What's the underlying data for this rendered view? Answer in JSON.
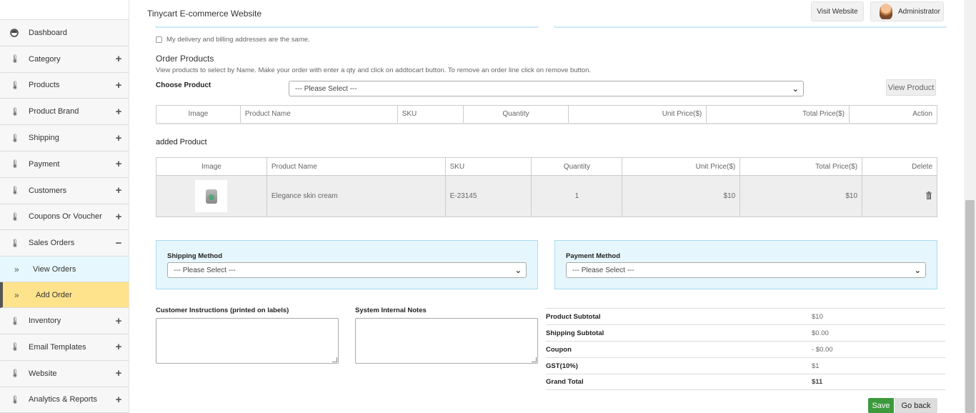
{
  "header": {
    "site_title": "Tinycart E-commerce Website",
    "visit_label": "Visit Website",
    "admin_label": "Administrator"
  },
  "sidebar": {
    "items": [
      {
        "label": "Dashboard",
        "icon": "dashboard-icon",
        "expand": ""
      },
      {
        "label": "Category",
        "icon": "thermometer-icon",
        "expand": "+"
      },
      {
        "label": "Products",
        "icon": "thermometer-icon",
        "expand": "+"
      },
      {
        "label": "Product Brand",
        "icon": "thermometer-icon",
        "expand": "+"
      },
      {
        "label": "Shipping",
        "icon": "thermometer-icon",
        "expand": "+"
      },
      {
        "label": "Payment",
        "icon": "thermometer-icon",
        "expand": "+"
      },
      {
        "label": "Customers",
        "icon": "thermometer-icon",
        "expand": "+"
      },
      {
        "label": "Coupons Or Voucher",
        "icon": "thermometer-icon",
        "expand": "+"
      },
      {
        "label": "Sales Orders",
        "icon": "thermometer-icon",
        "expand": "−"
      }
    ],
    "sub_items": [
      {
        "label": "View Orders",
        "icon": "double-chevron-icon"
      },
      {
        "label": "Add Order",
        "icon": "double-chevron-icon"
      }
    ],
    "items_after": [
      {
        "label": "Inventory",
        "icon": "thermometer-icon",
        "expand": "+"
      },
      {
        "label": "Email Templates",
        "icon": "thermometer-icon",
        "expand": "+"
      },
      {
        "label": "Website",
        "icon": "thermometer-icon",
        "expand": "+"
      },
      {
        "label": "Analytics & Reports",
        "icon": "thermometer-icon",
        "expand": "+"
      }
    ]
  },
  "form": {
    "same_address_label": "My delivery and billing addresses are the same.",
    "order_products_title": "Order Products",
    "order_products_desc": "View products to select by Name. Make your order with enter a qty and click on addtocart button. To remove an order line click on remove button.",
    "choose_product_label": "Choose Product",
    "choose_product_value": "--- Please Select ---",
    "view_product_label": "View Product"
  },
  "search_table": {
    "headers": [
      "Image",
      "Product Name",
      "SKU",
      "Quantity",
      "Unit Price($)",
      "Total Price($)",
      "Action"
    ]
  },
  "added_table": {
    "title": "added Product",
    "headers": [
      "Image",
      "Product Name",
      "SKU",
      "Quantity",
      "Unit Price($)",
      "Total Price($)",
      "Delete"
    ],
    "rows": [
      {
        "name": "Elegance skin cream",
        "sku": "E-23145",
        "qty": "1",
        "unit": "$10",
        "total": "$10"
      }
    ]
  },
  "shipping": {
    "label": "Shipping Method",
    "value": "--- Please Select ---"
  },
  "payment": {
    "label": "Payment Method",
    "value": "--- Please Select ---"
  },
  "notes": {
    "customer_label": "Customer Instructions (printed on labels)",
    "internal_label": "System Internal Notes"
  },
  "totals": [
    {
      "label": "Product Subtotal",
      "value": "$10"
    },
    {
      "label": "Shipping Subtotal",
      "value": "$0.00"
    },
    {
      "label": "Coupon",
      "value": "- $0.00"
    },
    {
      "label": "GST(10%)",
      "value": "$1"
    },
    {
      "label": "Grand Total",
      "value": "$11"
    }
  ],
  "actions": {
    "save_label": "Save",
    "back_label": "Go back"
  },
  "colors": {
    "active_sub_bg": "#ffe38c",
    "view_sub_bg": "#e6f7fd",
    "panel_bg": "#e6f6fd",
    "save_bg": "#3c9a3c"
  }
}
